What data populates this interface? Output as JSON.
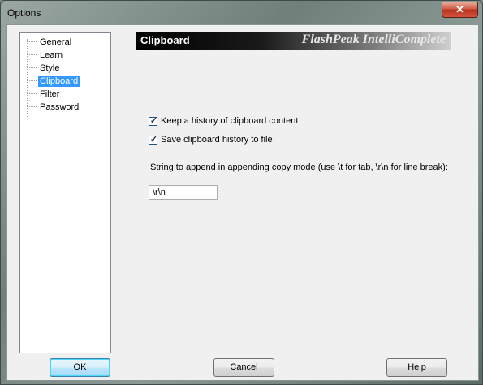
{
  "window": {
    "title": "Options",
    "close_label": "✕"
  },
  "tree": {
    "items": [
      {
        "label": "General"
      },
      {
        "label": "Learn"
      },
      {
        "label": "Style"
      },
      {
        "label": "Clipboard",
        "selected": true
      },
      {
        "label": "Filter"
      },
      {
        "label": "Password"
      }
    ]
  },
  "panel": {
    "title": "Clipboard",
    "brand": "FlashPeak IntelliComplete",
    "options": [
      {
        "label": "Keep a history of clipboard content",
        "checked": true
      },
      {
        "label": "Save clipboard history to file",
        "checked": true
      }
    ],
    "append_label": "String to append in appending copy mode (use \\t for tab, \\r\\n for line break):",
    "append_value": "\\r\\n"
  },
  "buttons": {
    "ok": "OK",
    "cancel": "Cancel",
    "help": "Help"
  },
  "colors": {
    "selection": "#3399ff",
    "close_button": "#c8402a"
  }
}
